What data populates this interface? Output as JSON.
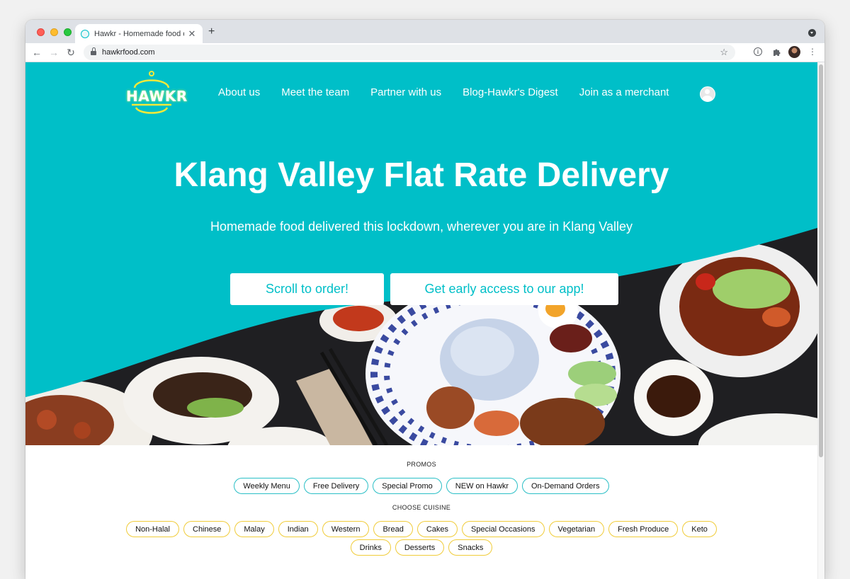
{
  "browser": {
    "tab_title": "Hawkr - Homemade food deliv",
    "url": "hawkrfood.com"
  },
  "site": {
    "logo_text": "HAWKR",
    "nav": [
      {
        "label": "About us"
      },
      {
        "label": "Meet the team"
      },
      {
        "label": "Partner with us"
      },
      {
        "label": "Blog-Hawkr's Digest"
      },
      {
        "label": "Join as a merchant"
      }
    ],
    "hero": {
      "title": "Klang Valley Flat Rate Delivery",
      "subtitle": "Homemade food delivered this lockdown, wherever you are in Klang Valley",
      "cta_scroll": "Scroll to order!",
      "cta_app": "Get early access to our app!"
    },
    "colors": {
      "brand": "#00bfc8",
      "promo_border": "#2bbfc6",
      "cuisine_border": "#f0cc3a"
    }
  },
  "promos": {
    "label": "PROMOS",
    "items": [
      "Weekly Menu",
      "Free Delivery",
      "Special Promo",
      "NEW on Hawkr",
      "On-Demand Orders"
    ]
  },
  "cuisine": {
    "label": "CHOOSE CUISINE",
    "items": [
      "Non-Halal",
      "Chinese",
      "Malay",
      "Indian",
      "Western",
      "Bread",
      "Cakes",
      "Special Occasions",
      "Vegetarian",
      "Fresh Produce",
      "Keto",
      "Drinks",
      "Desserts",
      "Snacks"
    ]
  }
}
